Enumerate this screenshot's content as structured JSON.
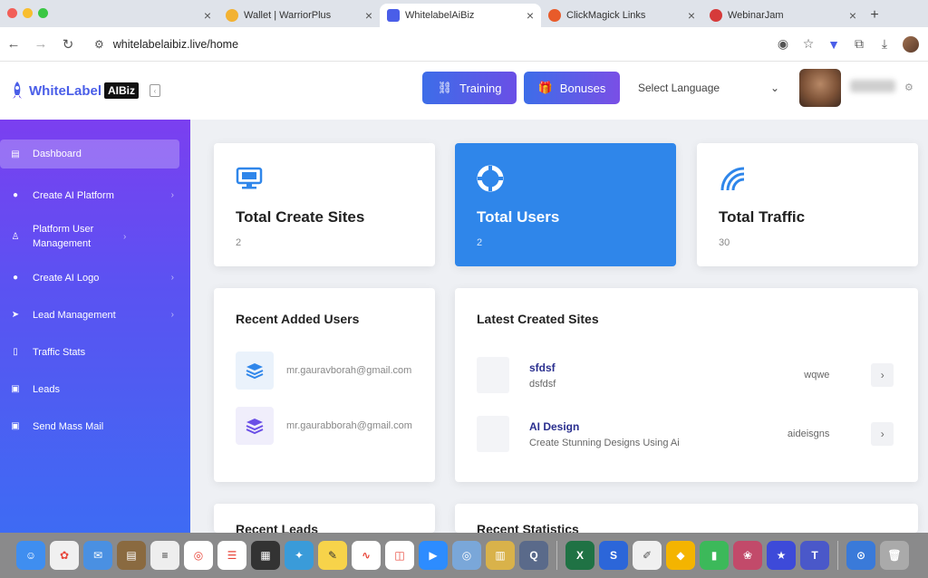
{
  "browser": {
    "tabs": [
      {
        "title": "",
        "blurred": true
      },
      {
        "title": "Wallet | WarriorPlus"
      },
      {
        "title": "WhitelabelAiBiz",
        "active": true
      },
      {
        "title": "ClickMagick Links"
      },
      {
        "title": "WebinarJam"
      }
    ],
    "url": "whitelabelaibiz.live/home"
  },
  "header": {
    "logo_text": "WhiteLabel",
    "logo_badge": "AIBiz",
    "training_label": "Training",
    "bonuses_label": "Bonuses",
    "language_label": "Select Language"
  },
  "sidebar": {
    "items": [
      {
        "label": "Dashboard",
        "icon": "dashboard-icon"
      },
      {
        "label": "Create AI Platform",
        "icon": "globe-icon"
      },
      {
        "label": "Platform User Management",
        "icon": "user-icon"
      },
      {
        "label": "Create AI Logo",
        "icon": "globe-icon"
      },
      {
        "label": "Lead Management",
        "icon": "send-icon"
      },
      {
        "label": "Traffic Stats",
        "icon": "phone-icon"
      },
      {
        "label": "Leads",
        "icon": "inbox-icon"
      },
      {
        "label": "Send Mass Mail",
        "icon": "inbox-icon"
      }
    ]
  },
  "stats": [
    {
      "title": "Total Create Sites",
      "value": "2",
      "icon": "monitor-icon"
    },
    {
      "title": "Total Users",
      "value": "2",
      "icon": "lifebuoy-icon"
    },
    {
      "title": "Total Traffic",
      "value": "30",
      "icon": "wifi-icon"
    }
  ],
  "recent_users": {
    "title": "Recent Added Users",
    "users": [
      {
        "email": "mr.gauravborah@gmail.com"
      },
      {
        "email": "mr.gaurabborah@gmail.com"
      }
    ]
  },
  "latest_sites": {
    "title": "Latest Created Sites",
    "sites": [
      {
        "name": "sfdsf",
        "desc": "dsfdsf",
        "slug": "wqwe"
      },
      {
        "name": "AI Design",
        "desc": "Create Stunning Designs Using Ai",
        "slug": "aideisgns"
      }
    ]
  },
  "bottom": {
    "recent_leads": "Recent Leads",
    "recent_statistics": "Recent Statistics"
  },
  "colors": {
    "accent": "#2f86ea",
    "sidebar_top": "#7b3ff0",
    "sidebar_bottom": "#3e6bf3"
  }
}
